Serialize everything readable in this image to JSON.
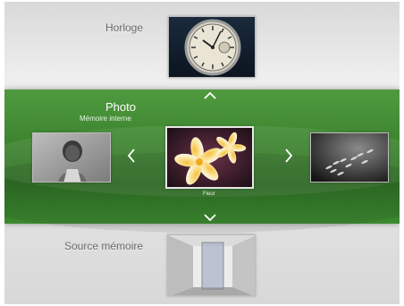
{
  "menu": {
    "clock": {
      "label": "Horloge"
    },
    "photo": {
      "title": "Photo",
      "subtitle": "Mémoire interne",
      "selected_caption": "Fleur"
    },
    "memory_source": {
      "label": "Source mémoire"
    }
  },
  "icons": {
    "up": "chevron-up-icon",
    "down": "chevron-down-icon",
    "left": "chevron-left-icon",
    "right": "chevron-right-icon"
  },
  "colors": {
    "band_green": "#3f8731",
    "background_grey": "#e2e2e2",
    "label_grey": "#6b6b6b"
  }
}
